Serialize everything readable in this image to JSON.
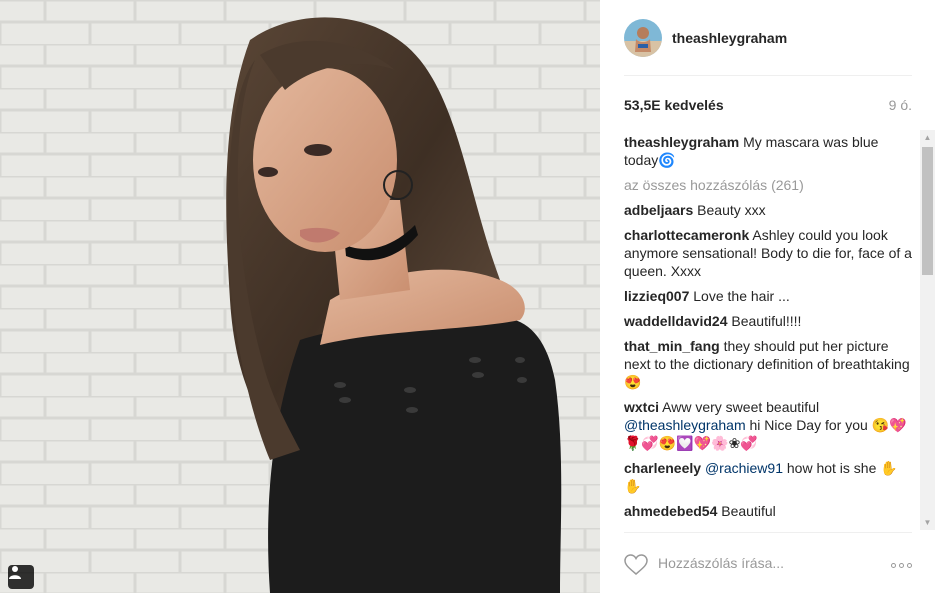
{
  "post": {
    "username": "theashleygraham",
    "likes": "53,5E kedvelés",
    "age": "9 ó.",
    "caption_user": "theashleygraham",
    "caption_text": "My mascara was blue today",
    "caption_emoji": "🌀",
    "all_comments": "az összes hozzászólás (261)"
  },
  "comments": [
    {
      "user": "adbeljaars",
      "pre": "Beauty xxx",
      "mention": "",
      "post": ""
    },
    {
      "user": "charlottecameronk",
      "pre": "Ashley could you look anymore sensational! Body to die for, face of a queen. Xxxx",
      "mention": "",
      "post": ""
    },
    {
      "user": "lizzieq007",
      "pre": "Love the hair ...",
      "mention": "",
      "post": ""
    },
    {
      "user": "waddelldavid24",
      "pre": "Beautiful!!!!",
      "mention": "",
      "post": ""
    },
    {
      "user": "that_min_fang",
      "pre": "they should put her picture next to the dictionary definition of breathtaking 😍",
      "mention": "",
      "post": ""
    },
    {
      "user": "wxtci",
      "pre": "Aww very sweet beautiful ",
      "mention": "@theashleygraham",
      "post": " hi Nice Day for you 😘💖🌹💞😍💟💖🌸❀💞"
    },
    {
      "user": "charleneely",
      "pre": "",
      "mention": "@rachiew91",
      "post": " how hot is she ✋✋"
    },
    {
      "user": "ahmedebed54",
      "pre": "Beautiful",
      "mention": "",
      "post": ""
    }
  ],
  "footer": {
    "comment_placeholder": "Hozzászólás írása..."
  },
  "icons": {
    "like": "heart-outline-icon",
    "more": "more-options-icon",
    "tag": "person-tag-icon"
  },
  "colors": {
    "username": "#262626",
    "mention": "#003569",
    "muted": "#999999",
    "divider": "#efefef"
  }
}
